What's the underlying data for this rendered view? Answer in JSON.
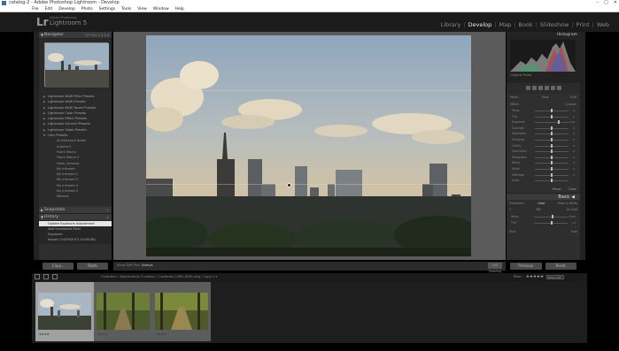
{
  "window": {
    "title": "catalog-2 - Adobe Photoshop Lightroom - Develop",
    "controls": [
      "–",
      "□",
      "✕"
    ]
  },
  "menu": [
    "File",
    "Edit",
    "Develop",
    "Photo",
    "Settings",
    "Tools",
    "View",
    "Window",
    "Help"
  ],
  "identity": {
    "logo": "Lr",
    "line1": "Adobe Photoshop",
    "line2": "Lightroom 5"
  },
  "modules": [
    "Library",
    "Develop",
    "Map",
    "Book",
    "Slideshow",
    "Print",
    "Web"
  ],
  "active_module": "Develop",
  "left_panel": {
    "navigator": {
      "title": "Navigator",
      "zoom": "FIT FILL 1:1 1:4"
    },
    "presets": [
      {
        "label": "Lightroom B&W Filter Presets",
        "child": false
      },
      {
        "label": "Lightroom B&W Presets",
        "child": false
      },
      {
        "label": "Lightroom B&W Toned Presets",
        "child": false
      },
      {
        "label": "Lightroom Color Presets",
        "child": false
      },
      {
        "label": "Lightroom Effect Presets",
        "child": false
      },
      {
        "label": "Lightroom General Presets",
        "child": false
      },
      {
        "label": "Lightroom Video Presets",
        "child": false
      },
      {
        "label": "User Presets",
        "child": false,
        "open": true
      },
      {
        "label": "Architecture detail",
        "child": true
      },
      {
        "label": "Autumn1",
        "child": true
      },
      {
        "label": "Foam Macro",
        "child": true
      },
      {
        "label": "Foam Macro 2",
        "child": true
      },
      {
        "label": "Haze_removal",
        "child": true
      },
      {
        "label": "My Infrared",
        "child": true
      },
      {
        "label": "My Infrared 2",
        "child": true
      },
      {
        "label": "My Infrared 3",
        "child": true
      },
      {
        "label": "My Infrared 4",
        "child": true
      },
      {
        "label": "My Infrared 5",
        "child": true
      },
      {
        "label": "Warmer",
        "child": true
      }
    ],
    "snapshots_title": "Snapshots",
    "history_title": "History",
    "history": [
      {
        "label": "Update Exposure Adjustment",
        "value": "",
        "selected": true
      },
      {
        "label": "Add Graduated Filter",
        "value": "",
        "selected": false
      },
      {
        "label": "Exposure",
        "value": "",
        "selected": false
      },
      {
        "label": "Import (14/09/2013 10:48:08)",
        "value": "",
        "selected": false
      }
    ],
    "copy_label": "Copy...",
    "paste_label": "Paste"
  },
  "toolbar": {
    "label": "Show Edit Pins :",
    "value": "Always",
    "softproof": "Soft Proofing"
  },
  "right_panel": {
    "histogram_title": "Histogram",
    "histogram_caption": "Original Photo",
    "mask_mode": [
      "Mask :",
      "New",
      "Edit"
    ],
    "effect_label": "Effect :",
    "effect_value": "Custom",
    "sliders": [
      {
        "name": "Temp",
        "value": "0",
        "pos": 0.5
      },
      {
        "name": "Tint",
        "value": "0",
        "pos": 0.5
      },
      {
        "name": "Exposure",
        "value": "1.06",
        "pos": 0.72
      },
      {
        "name": "Contrast",
        "value": "0",
        "pos": 0.5
      },
      {
        "name": "Highlights",
        "value": "0",
        "pos": 0.5
      },
      {
        "name": "Shadows",
        "value": "0",
        "pos": 0.5
      },
      {
        "name": "Clarity",
        "value": "0",
        "pos": 0.5
      },
      {
        "name": "Saturation",
        "value": "0",
        "pos": 0.5
      },
      {
        "name": "Sharpness",
        "value": "0",
        "pos": 0.5
      },
      {
        "name": "Noise",
        "value": "0",
        "pos": 0.5
      },
      {
        "name": "Moiré",
        "value": "0",
        "pos": 0.5
      },
      {
        "name": "Defringe",
        "value": "0",
        "pos": 0.5
      },
      {
        "name": "Color",
        "value": "",
        "pos": 0.5
      }
    ],
    "reset_label": "Reset",
    "close_label": "Close",
    "basic_title": "Basic",
    "treatment": {
      "label": "Treatment :",
      "color": "Color",
      "bw": "Black & White"
    },
    "wb": {
      "label": "WB :",
      "value": "As Shot"
    },
    "basic_sliders": [
      {
        "name": "Temp",
        "value": "5300",
        "pos": 0.55
      },
      {
        "name": "Tint",
        "value": "+2",
        "pos": 0.52
      }
    ],
    "tone_label": "Tone",
    "auto_label": "Auto",
    "previous_label": "Previous",
    "reset_btn_label": "Reset"
  },
  "filmstrip": {
    "info": "Collection : Adjustments     3 photos / 1 selected / IMG_8061.dng / Copy 1 ▾",
    "filter_label": "Filter :",
    "filter_value": "Filters Off",
    "items": [
      {
        "id": "city",
        "selected": true,
        "stars": "★★★★"
      },
      {
        "id": "forest1",
        "selected": false,
        "stars": "★★★★"
      },
      {
        "id": "forest2",
        "selected": false,
        "stars": "★★★★"
      }
    ]
  }
}
